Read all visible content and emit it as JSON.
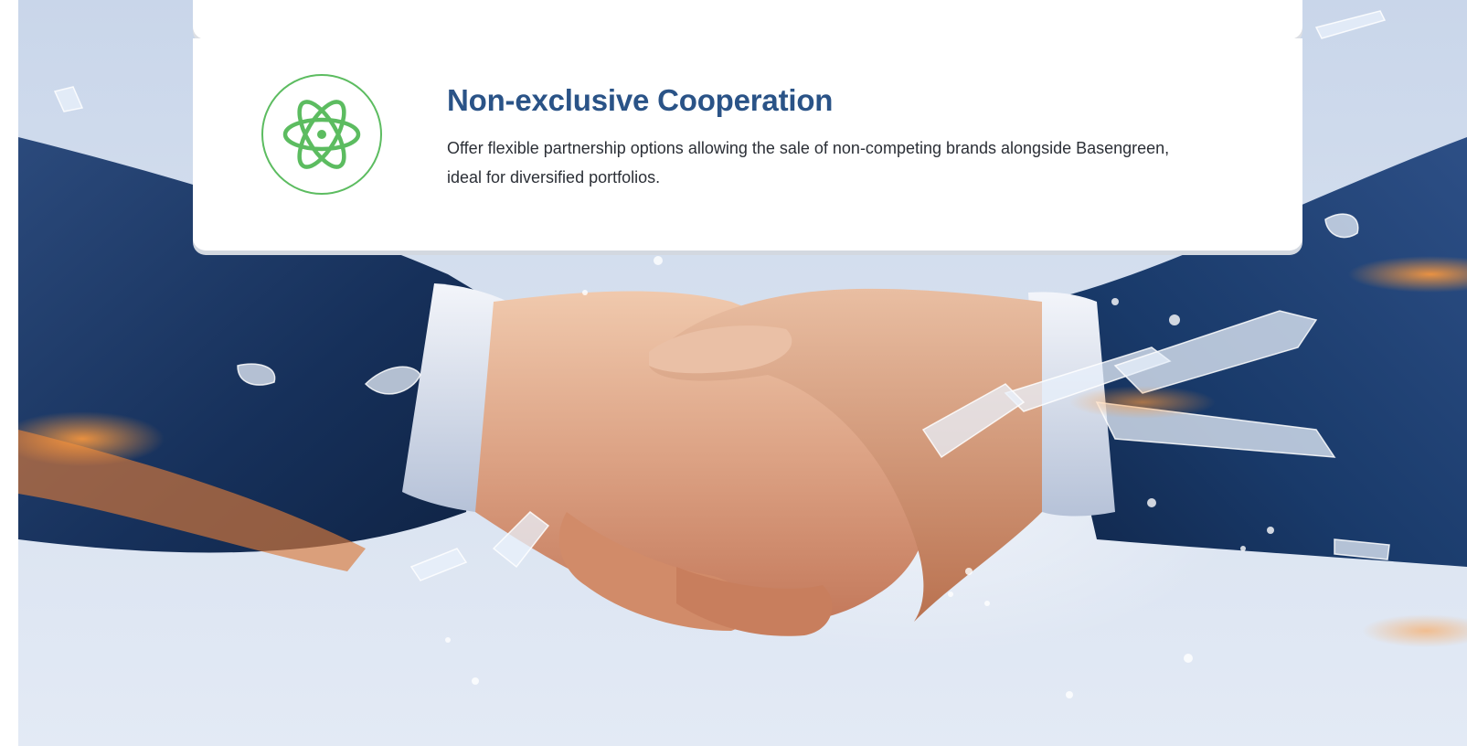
{
  "feature": {
    "icon": "atom-icon",
    "title": "Non-exclusive Cooperation",
    "description": "Offer flexible partnership options allowing the sale of non-competing brands alongside Basengreen, ideal for diversified portfolios."
  },
  "hero_image": {
    "subject": "handshake"
  },
  "colors": {
    "accent_green": "#5cbc60",
    "title_blue": "#2a5387",
    "text_dark": "#2b2f36",
    "card_bg": "#ffffff"
  }
}
